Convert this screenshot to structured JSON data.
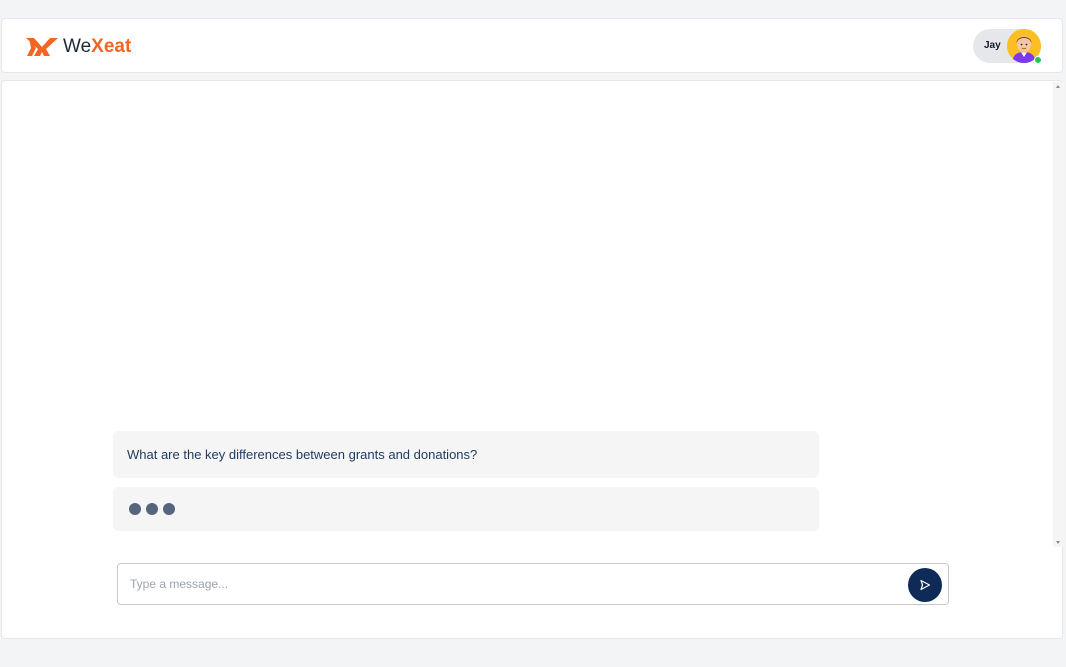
{
  "header": {
    "logo": {
      "text_prefix": "We",
      "text_accent": "Xeat"
    },
    "user": {
      "name": "Jay",
      "status": "online"
    }
  },
  "chat": {
    "messages": [
      {
        "role": "user",
        "text": "What are the key differences between grants and donations?"
      },
      {
        "role": "assistant",
        "state": "typing"
      }
    ]
  },
  "composer": {
    "placeholder": "Type a message...",
    "value": "",
    "send_icon": "send-icon"
  },
  "colors": {
    "brand": "#f26522",
    "send_button": "#0f2a57",
    "typing_dot": "#56657e",
    "online": "#22c55e"
  }
}
